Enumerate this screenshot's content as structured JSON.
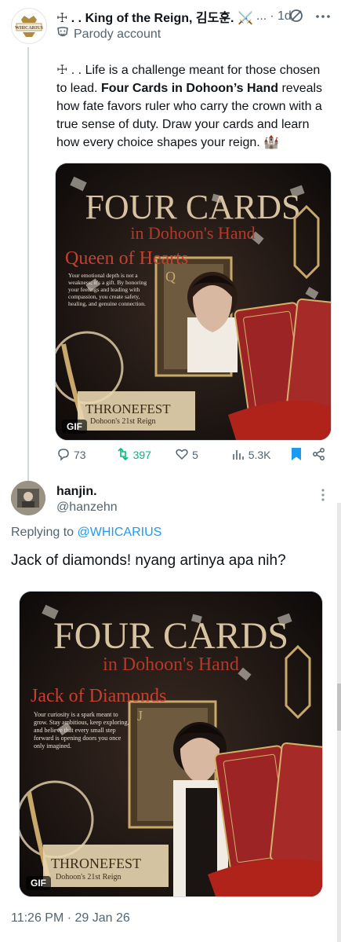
{
  "tweet": {
    "author_name": "☩ . . King of the Reign, 김도훈. ⚔️",
    "ellipsis": "...",
    "time_ago": "· 1d",
    "account_label": "Parody account",
    "text_part1": "☩ . . Life is a challenge meant for those chosen to lead. ",
    "text_bold": "Four Cards in Dohoon’s Hand",
    "text_part2": " reveals how fate favors ruler who carry the crown with a true sense of duty. Draw your cards and learn how every choice shapes your reign. 🏰",
    "avatar_text": "WHICARIUS",
    "media": {
      "title1": "FOUR CARDS",
      "title2": "in Dohoon's Hand",
      "card_title": "Queen of Hearts",
      "card_suit": "Q",
      "description": "Your emotional depth is not a weakness; it's a gift. By honoring your feelings and leading with compassion, you create safety, healing, and genuine connection.",
      "brand": "THRONEFEST",
      "brand_sub": "Dohoon's 21st Reign",
      "badge": "GIF"
    },
    "stats": {
      "replies": "73",
      "reposts": "397",
      "likes": "5",
      "views": "5.3K"
    }
  },
  "reply": {
    "name": "hanjin.",
    "handle": "@hanzehn",
    "replying_prefix": "Replying to ",
    "replying_to": "@WHICARIUS",
    "text": "Jack of diamonds! nyang artinya apa nih?",
    "media": {
      "title1": "FOUR CARDS",
      "title2": "in Dohoon's Hand",
      "card_title": "Jack of Diamonds",
      "card_suit": "J",
      "description": "Your curiosity is a spark meant to grow. Stay ambitious, keep exploring, and believe that every small step forward is opening doors you once only imagined.",
      "brand": "THRONEFEST",
      "brand_sub": "Dohoon's 21st Reign",
      "badge": "GIF"
    },
    "timestamp": "11:26 PM · 29 Jan 26"
  },
  "colors": {
    "accent": "#1d9bf0",
    "repost_green": "#00ba7c",
    "gold": "#c8a96a",
    "card_red": "#9c2424"
  }
}
